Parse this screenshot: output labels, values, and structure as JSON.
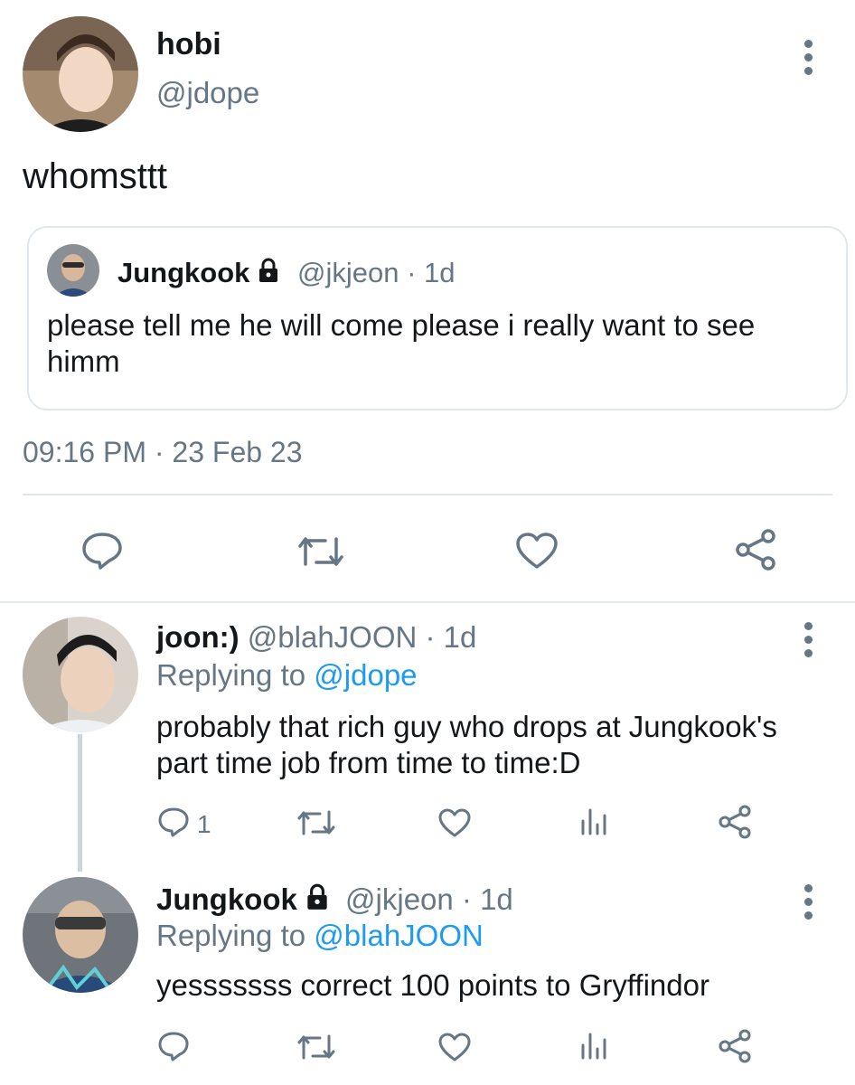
{
  "main_tweet": {
    "name": "hobi",
    "handle": "@jdope",
    "text": "whomsttt",
    "timestamp": "09:16 PM · 23 Feb 23",
    "quoted": {
      "name": "Jungkook",
      "handle": "@jkjeon · 1d",
      "text": "please tell me he will come please i really want to see himm"
    }
  },
  "replies": [
    {
      "name": "joon:)",
      "handle": "@blahJOON · 1d",
      "replying_prefix": "Replying to",
      "replying_to": "@jdope",
      "text": "probably that rich guy who drops at Jungkook's part time job from time to time:D",
      "reply_count": "1"
    },
    {
      "name": "Jungkook",
      "handle": "@jkjeon · 1d",
      "replying_prefix": "Replying to",
      "replying_to": "@blahJOON",
      "text": "yesssssss correct 100 points to Gryffindor",
      "reply_count": ""
    }
  ],
  "colors": {
    "text": "#14171a",
    "secondary": "#657786",
    "link": "#1d9bf0",
    "divider": "#e1e8ed"
  },
  "icons": [
    "reply-icon",
    "retweet-icon",
    "like-icon",
    "share-icon",
    "analytics-icon",
    "more-icon",
    "lock-icon"
  ]
}
